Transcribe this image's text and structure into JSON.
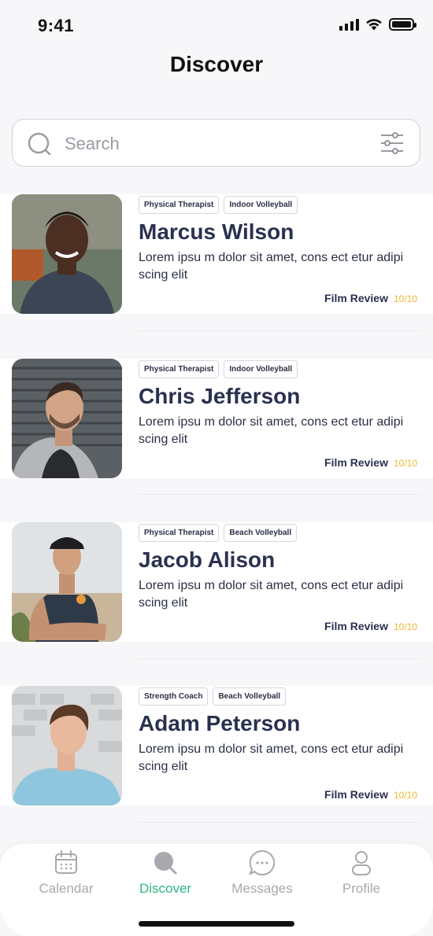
{
  "status_bar": {
    "time": "9:41"
  },
  "header": {
    "title": "Discover"
  },
  "search": {
    "placeholder": "Search",
    "value": ""
  },
  "cards": [
    {
      "tags": [
        "Physical Therapist",
        "Indoor Volleyball"
      ],
      "name": "Marcus Wilson",
      "description": "Lorem ipsu m dolor sit amet, cons ect etur adipi scing elit",
      "review_label": "Film Review",
      "review_score": "10/10"
    },
    {
      "tags": [
        "Physical Therapist",
        "Indoor Volleyball"
      ],
      "name": "Chris Jefferson",
      "description": "Lorem ipsu m dolor sit amet, cons ect etur adipi scing elit",
      "review_label": "Film Review",
      "review_score": "10/10"
    },
    {
      "tags": [
        "Physical Therapist",
        "Beach Volleyball"
      ],
      "name": "Jacob Alison",
      "description": "Lorem ipsu m dolor sit amet, cons ect etur adipi scing elit",
      "review_label": "Film Review",
      "review_score": "10/10"
    },
    {
      "tags": [
        "Strength Coach",
        "Beach Volleyball"
      ],
      "name": "Adam Peterson",
      "description": "Lorem ipsu m dolor sit amet, cons ect etur adipi scing elit",
      "review_label": "Film Review",
      "review_score": "10/10"
    }
  ],
  "bottom_nav": [
    {
      "label": "Calendar",
      "icon": "calendar-icon",
      "active": false
    },
    {
      "label": "Discover",
      "icon": "search-icon",
      "active": true
    },
    {
      "label": "Messages",
      "icon": "chat-bubble-icon",
      "active": false
    },
    {
      "label": "Profile",
      "icon": "person-icon",
      "active": false
    }
  ],
  "colors": {
    "accent": "#2fb880",
    "score": "#f2b632",
    "name": "#2a3150",
    "inactive": "#a7a9ae"
  }
}
